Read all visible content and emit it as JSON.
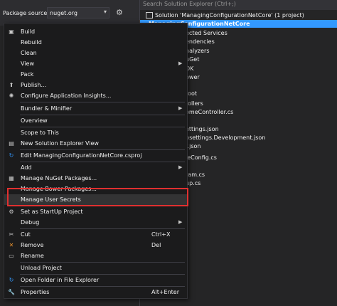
{
  "nuget": {
    "package_source_label": "Package source:",
    "package_source_value": "nuget.org"
  },
  "solution_explorer": {
    "search_placeholder": "Search Solution Explorer (Ctrl+;)",
    "rows": [
      "Solution 'ManagingConfigurationNetCore' (1 project)",
      "ManagingConfigurationNetCore",
      "ected Services",
      "endencies",
      "nalyzers",
      "uGet",
      "DK",
      "ower",
      "root",
      "rollers",
      "omeController.cs",
      "ettings.json",
      "psettings.Development.json",
      "r.json",
      "leConfig.cs",
      "ram.cs",
      "up.cs"
    ]
  },
  "context_menu": {
    "build": "Build",
    "rebuild": "Rebuild",
    "clean": "Clean",
    "view": "View",
    "pack": "Pack",
    "publish": "Publish...",
    "configure_insights": "Configure Application Insights...",
    "bundler_minifier": "Bundler & Minifier",
    "overview": "Overview",
    "scope_to_this": "Scope to This",
    "new_solution_explorer_view": "New Solution Explorer View",
    "edit_csproj": "Edit ManagingConfigurationNetCore.csproj",
    "add": "Add",
    "manage_nuget": "Manage NuGet Packages...",
    "manage_bower": "Manage Bower Packages...",
    "manage_user_secrets": "Manage User Secrets",
    "set_startup": "Set as StartUp Project",
    "debug": "Debug",
    "cut": "Cut",
    "cut_shortcut": "Ctrl+X",
    "remove": "Remove",
    "remove_shortcut": "Del",
    "rename": "Rename",
    "unload_project": "Unload Project",
    "open_folder": "Open Folder in File Explorer",
    "properties": "Properties",
    "properties_shortcut": "Alt+Enter"
  },
  "colors": {
    "highlight_border": "#e03030",
    "selection": "#3399ff"
  }
}
